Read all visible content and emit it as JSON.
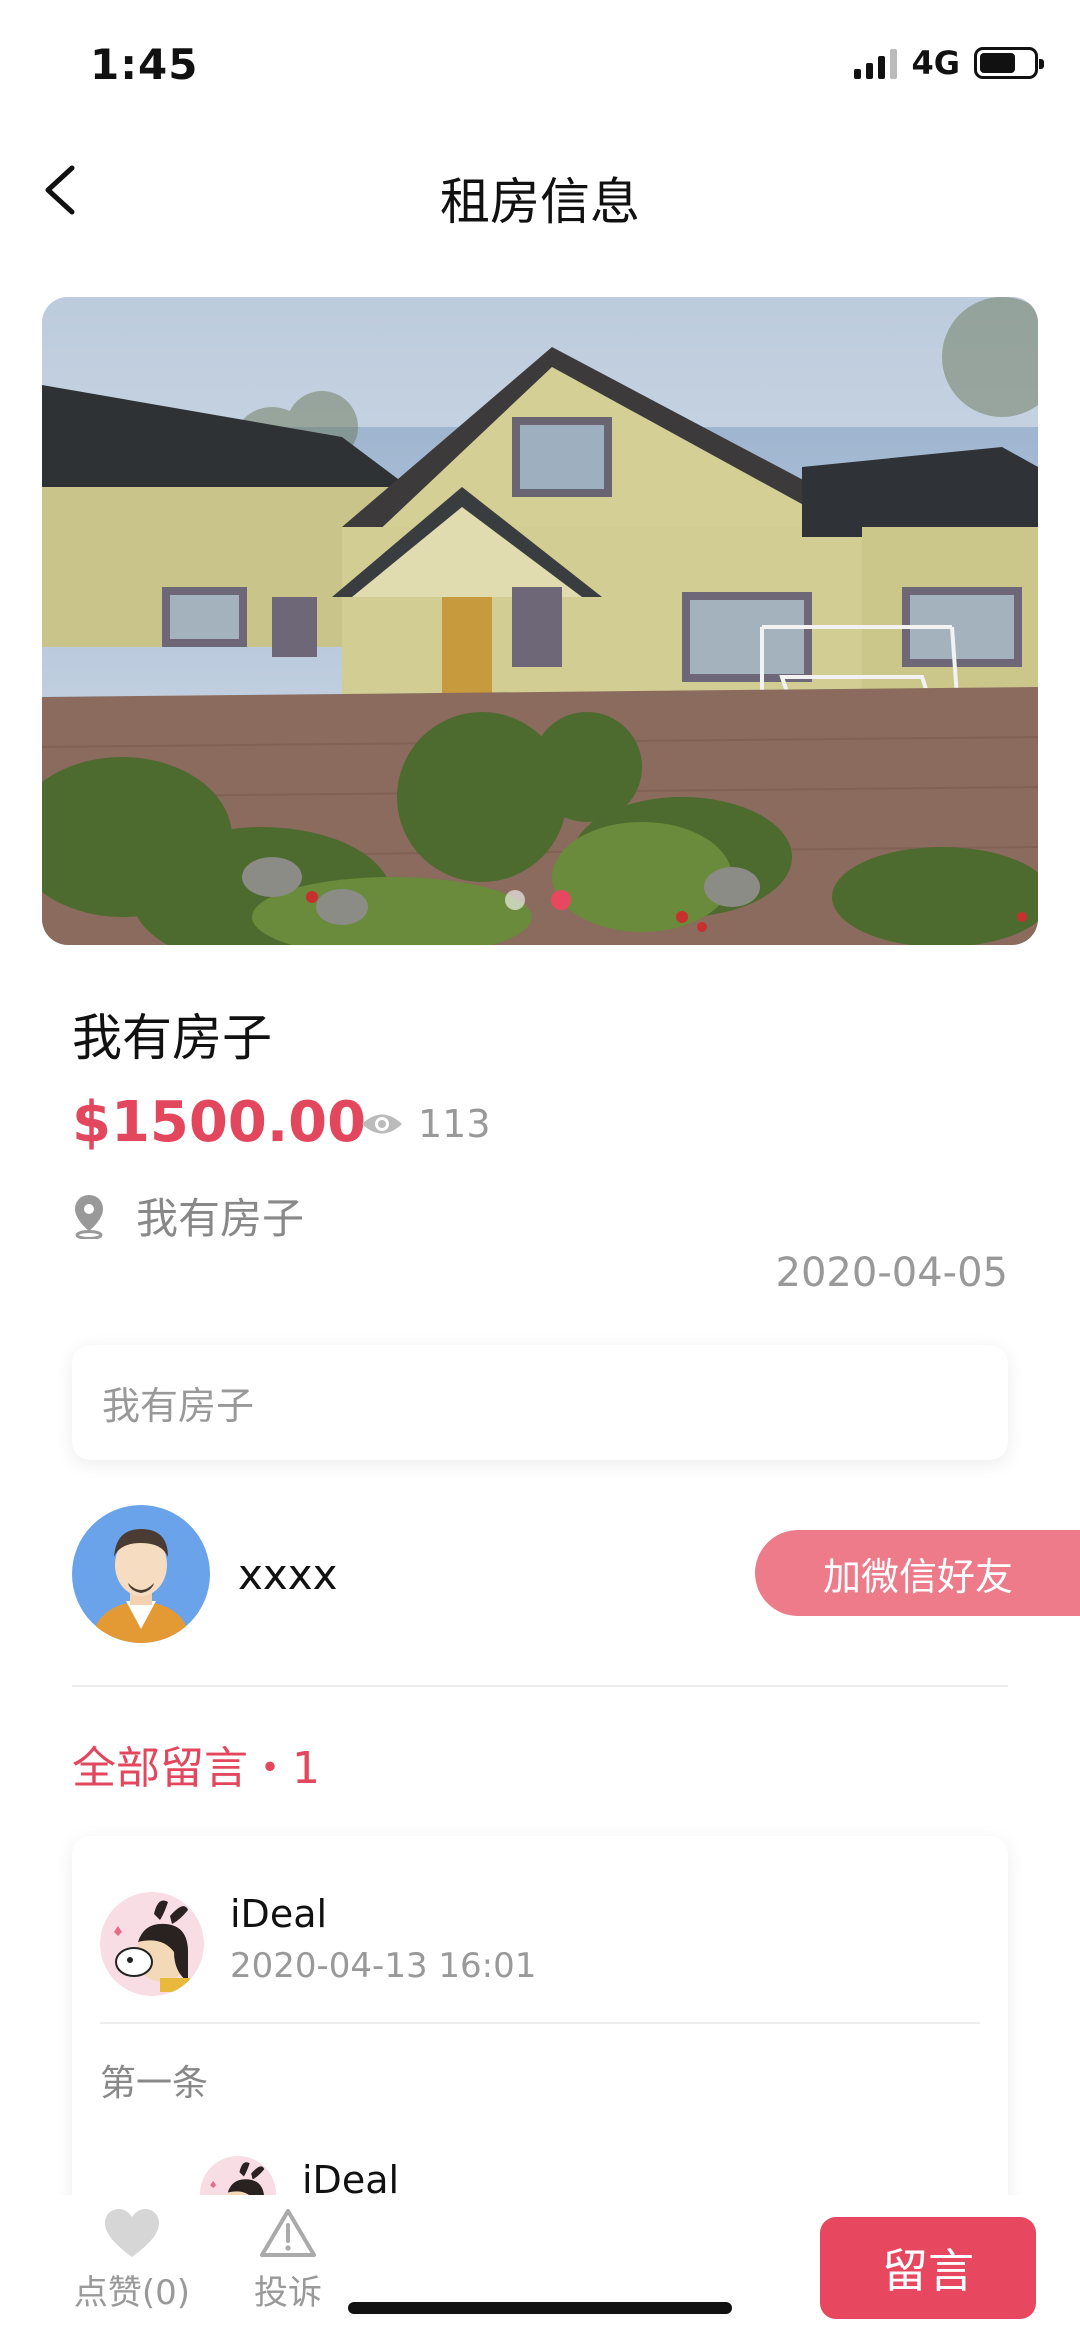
{
  "status_bar": {
    "time": "1:45",
    "network": "4G",
    "battery_percent": 68
  },
  "nav": {
    "title": "租房信息"
  },
  "gallery": {
    "image_count": 2,
    "active_index": 1
  },
  "listing": {
    "title": "我有房子",
    "price": "$1500.00",
    "views": "113",
    "location": "我有房子",
    "date": "2020-04-05",
    "description": "我有房子"
  },
  "owner": {
    "name": "xxxx",
    "wechat_button": "加微信好友"
  },
  "comments": {
    "header": "全部留言・1",
    "items": [
      {
        "user": "iDeal",
        "time": "2020-04-13 16:01",
        "text": "第一条",
        "replies": [
          {
            "user": "iDeal"
          }
        ]
      }
    ]
  },
  "bottom_bar": {
    "like_label": "点赞(0)",
    "report_label": "投诉",
    "comment_button": "留言"
  },
  "colors": {
    "accent": "#e8485f",
    "accent_light": "#ee7b8a",
    "muted_text": "#999999"
  }
}
